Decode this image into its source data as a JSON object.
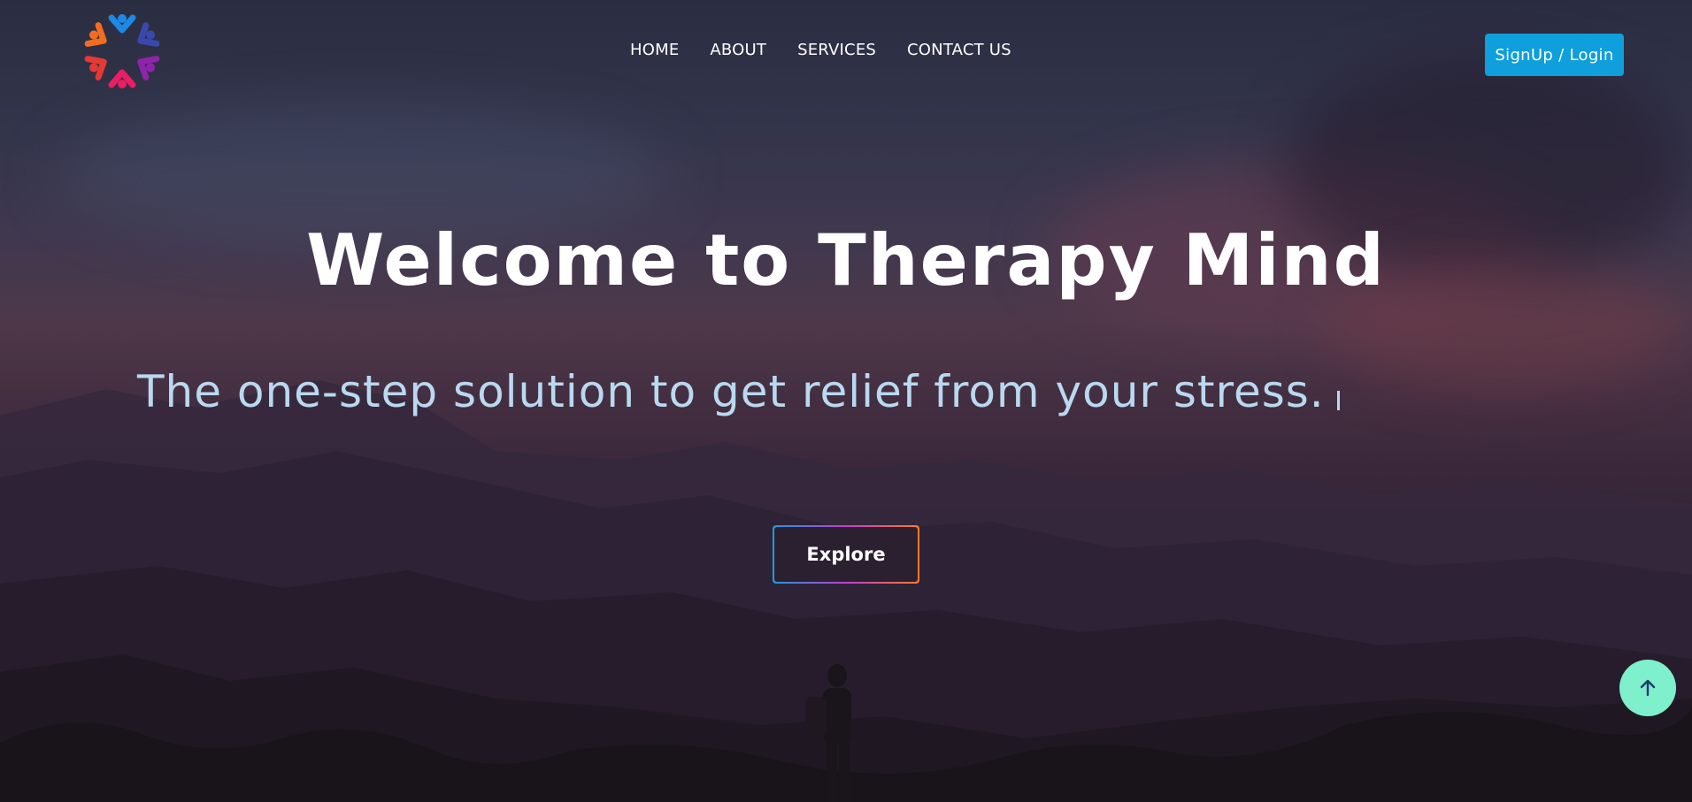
{
  "brand": {
    "logo_icon": "people-circle-logo-icon",
    "colors": [
      "#f26d21",
      "#e91e63",
      "#1e88e5",
      "#7b1fa2"
    ]
  },
  "nav": {
    "items": [
      {
        "label": "HOME"
      },
      {
        "label": "ABOUT"
      },
      {
        "label": "SERVICES"
      },
      {
        "label": "CONTACT US"
      }
    ]
  },
  "header": {
    "signup_label": "SignUp / Login",
    "signup_color": "#0e9fdc"
  },
  "hero": {
    "title": "Welcome to Therapy Mind",
    "subtitle": "The one-step solution to get relief from your stress.",
    "explore_label": "Explore"
  },
  "scroll_top": {
    "icon": "arrow-up-icon",
    "color": "#7ef0cc"
  }
}
